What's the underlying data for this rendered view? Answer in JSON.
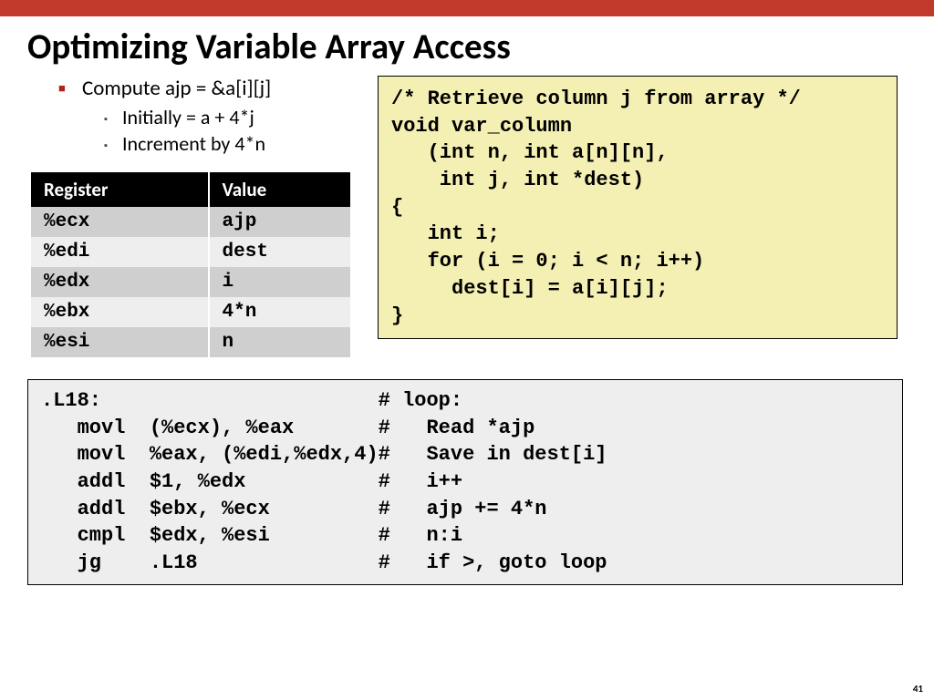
{
  "title": "Optimizing Variable Array Access",
  "bullets": {
    "main": "Compute ajp = &a[i][j]",
    "sub1": "Initially = a + 4*j",
    "sub2": "Increment by 4*n"
  },
  "table": {
    "headers": [
      "Register",
      "Value"
    ],
    "rows": [
      [
        "%ecx",
        "ajp"
      ],
      [
        "%edi",
        "dest"
      ],
      [
        "%edx",
        "i"
      ],
      [
        "%ebx",
        "4*n"
      ],
      [
        "%esi",
        "n"
      ]
    ]
  },
  "code_c": "/* Retrieve column j from array */\nvoid var_column\n   (int n, int a[n][n],\n    int j, int *dest)\n{\n   int i;\n   for (i = 0; i < n; i++)\n     dest[i] = a[i][j];\n}",
  "code_asm": ".L18:                       # loop:\n   movl  (%ecx), %eax       #   Read *ajp\n   movl  %eax, (%edi,%edx,4)#   Save in dest[i]\n   addl  $1, %edx           #   i++\n   addl  $ebx, %ecx         #   ajp += 4*n\n   cmpl  $edx, %esi         #   n:i\n   jg    .L18               #   if >, goto loop",
  "pagenum": "41"
}
